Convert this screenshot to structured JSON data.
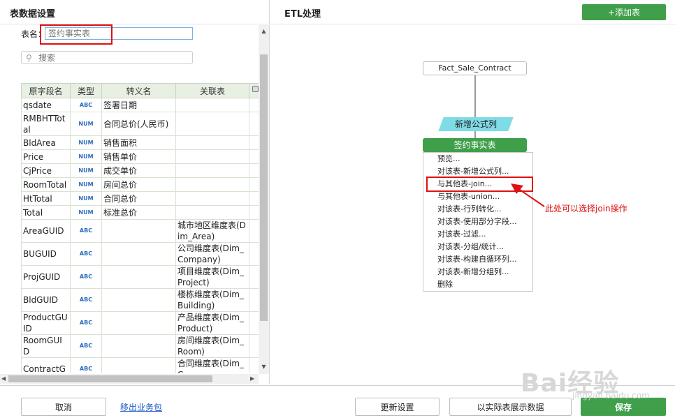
{
  "left": {
    "title": "表数据设置",
    "name_label": "表名：",
    "name_placeholder": "签约事实表",
    "search_placeholder": "搜索",
    "columns": [
      "原字段名",
      "类型",
      "转义名",
      "关联表"
    ],
    "rows": [
      {
        "orig": "qsdate",
        "type": "ABC",
        "alias": "签署日期",
        "rel": ""
      },
      {
        "orig": "RMBHTTotal",
        "type": "NUM",
        "alias": "合同总价(人民币)",
        "rel": ""
      },
      {
        "orig": "BldArea",
        "type": "NUM",
        "alias": "销售面积",
        "rel": ""
      },
      {
        "orig": "Price",
        "type": "NUM",
        "alias": "销售单价",
        "rel": ""
      },
      {
        "orig": "CjPrice",
        "type": "NUM",
        "alias": "成交单价",
        "rel": ""
      },
      {
        "orig": "RoomTotal",
        "type": "NUM",
        "alias": "房间总价",
        "rel": ""
      },
      {
        "orig": "HtTotal",
        "type": "NUM",
        "alias": "合同总价",
        "rel": ""
      },
      {
        "orig": "Total",
        "type": "NUM",
        "alias": "标准总价",
        "rel": ""
      },
      {
        "orig": "AreaGUID",
        "type": "ABC",
        "alias": "",
        "rel": "城市地区维度表(Dim_Area)"
      },
      {
        "orig": "BUGUID",
        "type": "ABC",
        "alias": "",
        "rel": "公司维度表(Dim_Company)"
      },
      {
        "orig": "ProjGUID",
        "type": "ABC",
        "alias": "",
        "rel": "项目维度表(Dim_Project)"
      },
      {
        "orig": "BldGUID",
        "type": "ABC",
        "alias": "",
        "rel": "楼栋维度表(Dim_Building)"
      },
      {
        "orig": "ProductGUID",
        "type": "ABC",
        "alias": "",
        "rel": "产品维度表(Dim_Product)"
      },
      {
        "orig": "RoomGUID",
        "type": "ABC",
        "alias": "",
        "rel": "房间维度表(Dim_Room)"
      },
      {
        "orig": "ContractG",
        "type": "ABC",
        "alias": "",
        "rel": "合同维度表(Dim_C"
      }
    ]
  },
  "right": {
    "title": "ETL处理",
    "add_table_label": "+添加表",
    "source_node": "Fact_Sale_Contract",
    "formula_node": "新增公式列",
    "main_node": "签约事实表",
    "menu_items": [
      "预览...",
      "对该表-新增公式列...",
      "与其他表-join...",
      "与其他表-union...",
      "对该表-行列转化...",
      "对该表-使用部分字段...",
      "对该表-过滤...",
      "对该表-分组/统计...",
      "对该表-构建自循环列...",
      "对该表-新增分组列...",
      "删除"
    ],
    "annotation": "此处可以选择join操作"
  },
  "bottom": {
    "cancel": "取消",
    "remove_link": "移出业务包",
    "update": "更新设置",
    "show_real": "以实际表展示数据",
    "save": "保存"
  },
  "watermark": {
    "logo": "Bai经验",
    "url": "jingyan.baidu.com"
  },
  "colors": {
    "accent_green": "#3f9f4a",
    "highlight_red": "#e01010",
    "formula_cyan": "#7fdbe6"
  }
}
